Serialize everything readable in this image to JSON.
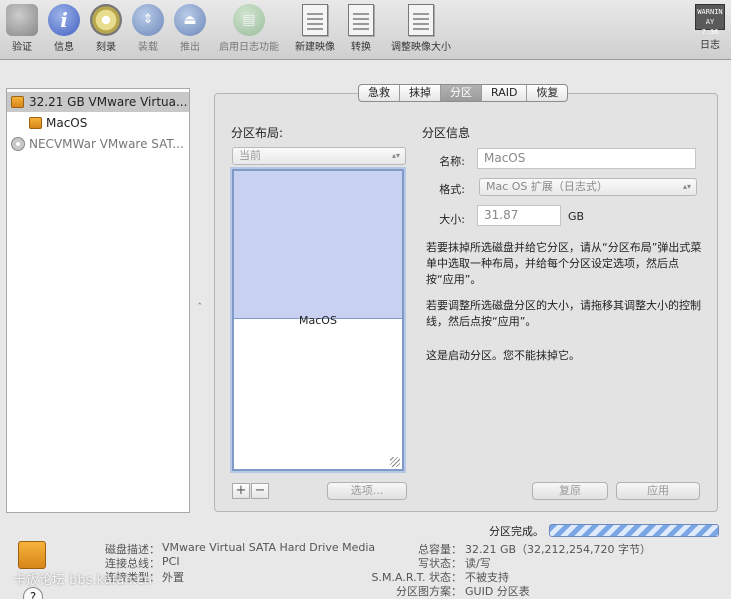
{
  "toolbar": {
    "verify": "验证",
    "info": "信息",
    "burn": "刻录",
    "mount": "装载",
    "eject": "推出",
    "enable_journaling": "启用日志功能",
    "new_image": "新建映像",
    "convert": "转换",
    "resize_image": "调整映像大小",
    "log": "日志",
    "log_icon_text": "WARNIN AY 7:36"
  },
  "sidebar": {
    "items": [
      {
        "label": "32.21 GB VMware Virtua...",
        "icon": "disk-icon",
        "selected": true
      },
      {
        "label": "MacOS",
        "icon": "volume-icon",
        "selected": false
      },
      {
        "label": "NECVMWar VMware SAT...",
        "icon": "optical-drive-icon",
        "selected": false
      }
    ]
  },
  "tabs": [
    "急救",
    "抹掉",
    "分区",
    "RAID",
    "恢复"
  ],
  "active_tab": "分区",
  "partition_layout": {
    "title": "分区布局:",
    "popup_value": "当前",
    "partition_name": "MacOS",
    "add": "+",
    "remove": "−",
    "options_button": "选项..."
  },
  "partition_info": {
    "title": "分区信息",
    "name_label": "名称:",
    "name_value": "MacOS",
    "format_label": "格式:",
    "format_value": "Mac OS 扩展（日志式）",
    "size_label": "大小:",
    "size_value": "31.87",
    "size_unit": "GB",
    "para1": "若要抹掉所选磁盘并给它分区，请从“分区布局”弹出式菜单中选取一种布局，并给每个分区设定选项，然后点按“应用”。",
    "para2": "若要调整所选磁盘分区的大小，请拖移其调整大小的控制线，然后点按“应用”。",
    "para3": "这是启动分区。您不能抹掉它。",
    "revert_button": "复原",
    "apply_button": "应用"
  },
  "status": {
    "label": "分区完成。",
    "progress": 1.0,
    "disk_description_label": "磁盘描述：",
    "disk_description": "VMware Virtual SATA Hard Drive Media",
    "bus_label": "连接总线：",
    "bus": "PCI",
    "type_label": "连接类型：",
    "type": "外置",
    "capacity_label": "总容量：",
    "capacity": "32.21 GB（32,212,254,720 字节）",
    "write_status_label": "写状态：",
    "write_status": "读/写",
    "smart_label": "S.M.A.R.T. 状态：",
    "smart": "不被支持",
    "scheme_label": "分区图方案：",
    "scheme": "GUID 分区表"
  },
  "help": "?",
  "watermark": "卡饭论坛 bbs.kafan.cn"
}
